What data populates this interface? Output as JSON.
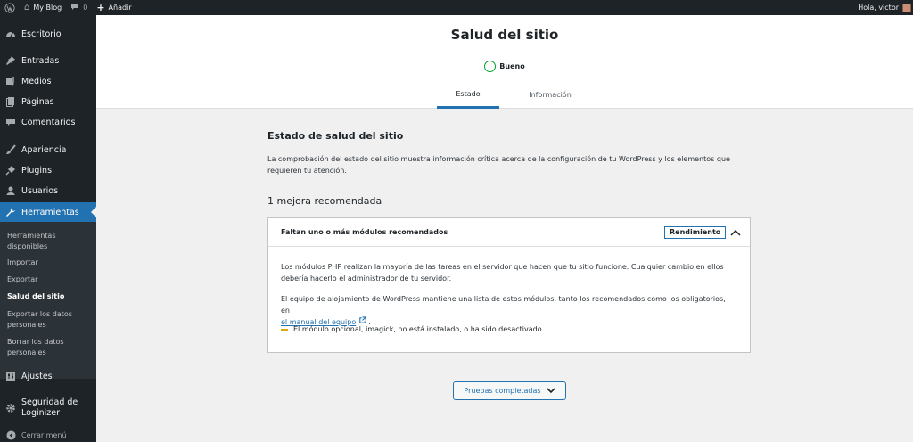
{
  "adminbar": {
    "site_name": "My Blog",
    "comments_count": "0",
    "add_new": "Añadir",
    "greeting": "Hola, victor"
  },
  "sidebar": {
    "items": {
      "escritorio": "Escritorio",
      "entradas": "Entradas",
      "medios": "Medios",
      "paginas": "Páginas",
      "comentarios": "Comentarios",
      "apariencia": "Apariencia",
      "plugins": "Plugins",
      "usuarios": "Usuarios",
      "herramientas": "Herramientas",
      "ajustes": "Ajustes",
      "seguridad_line1": "Seguridad de",
      "seguridad_line2": "Loginizer",
      "cerrar_menu": "Cerrar menú"
    },
    "submenu": {
      "herramientas_line1": "Herramientas",
      "herramientas_line2": "disponibles",
      "importar": "Importar",
      "exportar": "Exportar",
      "salud": "Salud del sitio",
      "exportar_datos_line1": "Exportar los datos",
      "exportar_datos_line2": "personales",
      "borrar_datos_line1": "Borrar los datos",
      "borrar_datos_line2": "personales"
    }
  },
  "header": {
    "title": "Salud del sitio",
    "status": "Bueno",
    "status_color": "#00a32a",
    "tabs": [
      "Estado",
      "Información"
    ]
  },
  "main": {
    "section_title": "Estado de salud del sitio",
    "section_desc": "La comprobación del estado del sitio muestra información crítica acerca de la configuración de tu WordPress y los elementos que requieren tu atención.",
    "issues_count": "1 mejora recomendada",
    "issue": {
      "title": "Faltan uno o más módulos recomendados",
      "badge": "Rendimiento",
      "p1": "Los módulos PHP realizan la mayoría de las tareas en el servidor que hacen que tu sitio funcione. Cualquier cambio en ellos debería hacerlo el administrador de tu servidor.",
      "p2": "El equipo de alojamiento de WordPress mantiene una lista de estos módulos, tanto los recomendados como los obligatorios, en",
      "link": "el manual del equipo",
      "p2_end": ".",
      "item": "El módulo opcional, imagick, no está instalado, o ha sido desactivado."
    },
    "tests_button": "Pruebas completadas"
  },
  "colors": {
    "accent": "#2271b1",
    "sidebar_bg": "#1d2327",
    "warning": "#dba617"
  }
}
